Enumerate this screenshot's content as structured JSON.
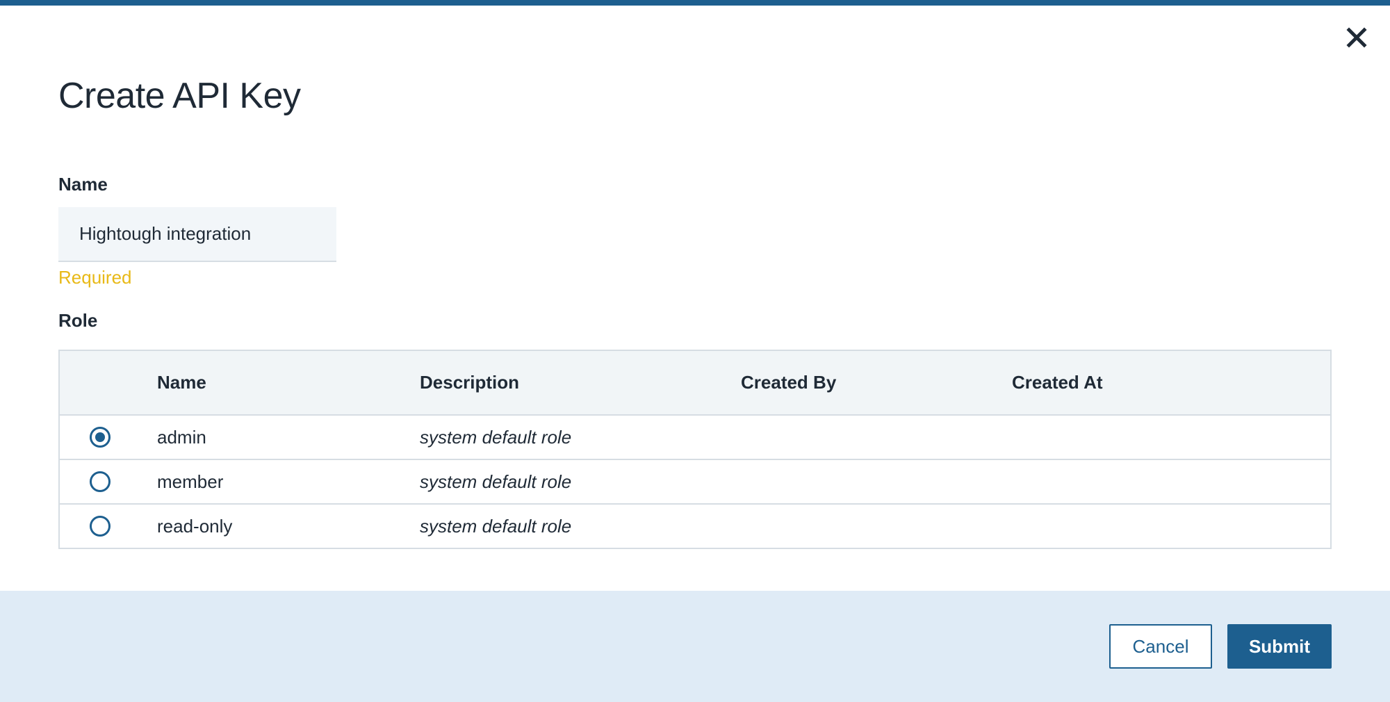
{
  "dialog": {
    "title": "Create API Key",
    "close_icon": "close-icon"
  },
  "name_field": {
    "label": "Name",
    "value": "Hightough integration",
    "helper_text": "Required",
    "helper_color": "#e8b917"
  },
  "role_field": {
    "label": "Role",
    "columns": [
      "Name",
      "Description",
      "Created By",
      "Created At"
    ],
    "rows": [
      {
        "name": "admin",
        "description": "system default role",
        "created_by": "",
        "created_at": "",
        "selected": true
      },
      {
        "name": "member",
        "description": "system default role",
        "created_by": "",
        "created_at": "",
        "selected": false
      },
      {
        "name": "read-only",
        "description": "system default role",
        "created_by": "",
        "created_at": "",
        "selected": false
      }
    ]
  },
  "footer": {
    "cancel_label": "Cancel",
    "submit_label": "Submit"
  },
  "colors": {
    "accent": "#1d5f8f",
    "footer_bg": "#dfebf6",
    "table_header_bg": "#f1f5f7",
    "input_bg": "#f2f6f9"
  }
}
